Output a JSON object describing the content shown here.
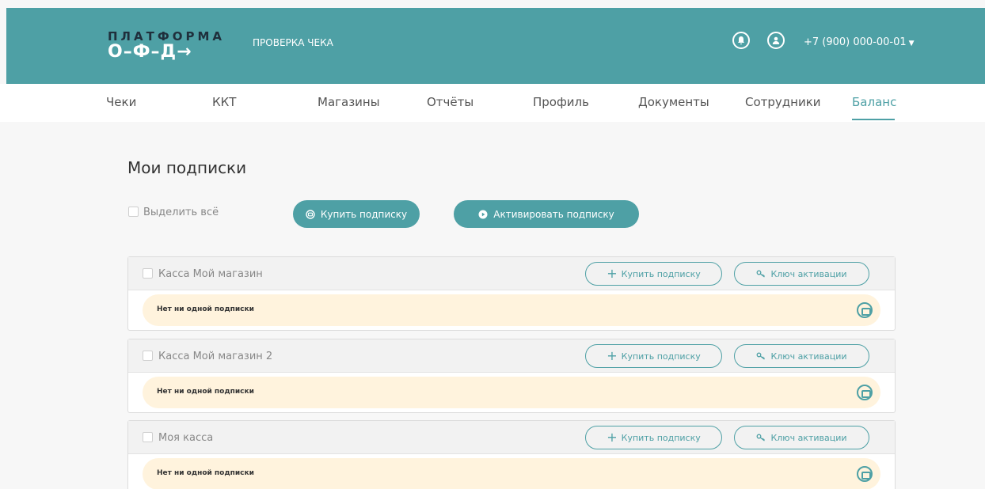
{
  "brand": {
    "top": "ПЛАТФОРМА",
    "bottom": "О–Ф–Д→"
  },
  "header": {
    "check_link": "ПРОВЕРКА ЧЕКА",
    "phone": "+7 (900) 000-00-01",
    "accent": "#4ea0a5"
  },
  "nav": {
    "items": [
      {
        "label": "Чеки"
      },
      {
        "label": "ККТ"
      },
      {
        "label": "Магазины"
      },
      {
        "label": "Отчёты"
      },
      {
        "label": "Профиль"
      },
      {
        "label": "Документы"
      },
      {
        "label": "Сотрудники"
      },
      {
        "label": "Баланс",
        "active": true
      }
    ]
  },
  "main": {
    "title": "Мои подписки",
    "select_all": "Выделить всё",
    "buy_button": "Купить подписку",
    "activate_button": "Активировать подписку"
  },
  "cards": [
    {
      "name": "Касса Мой магазин",
      "buy": "Купить подписку",
      "key": "Ключ активации",
      "empty": "Нет ни одной подписки"
    },
    {
      "name": "Касса Мой магазин 2",
      "buy": "Купить подписку",
      "key": "Ключ активации",
      "empty": "Нет ни одной подписки"
    },
    {
      "name": "Моя касса",
      "buy": "Купить подписку",
      "key": "Ключ активации",
      "empty": "Нет ни одной подписки"
    }
  ]
}
